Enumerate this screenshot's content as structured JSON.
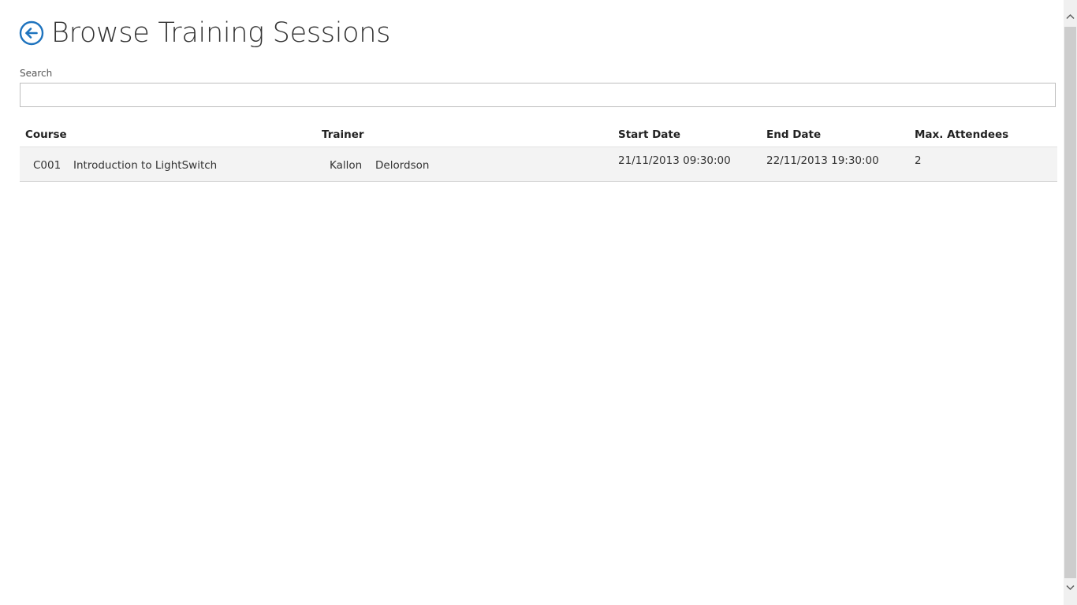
{
  "header": {
    "title": "Browse Training Sessions",
    "back_icon": "back-arrow-circle-icon",
    "accent_color": "#1e73be"
  },
  "search": {
    "label": "Search",
    "value": "",
    "placeholder": ""
  },
  "table": {
    "columns": {
      "course": "Course",
      "trainer": "Trainer",
      "start_date": "Start Date",
      "end_date": "End Date",
      "max_attendees": "Max. Attendees"
    },
    "rows": [
      {
        "course_code": "C001",
        "course_name": "Introduction to LightSwitch",
        "trainer_first": "Kallon",
        "trainer_last": "Delordson",
        "start_date": "21/11/2013 09:30:00",
        "end_date": "22/11/2013 19:30:00",
        "max_attendees": "2"
      }
    ]
  }
}
